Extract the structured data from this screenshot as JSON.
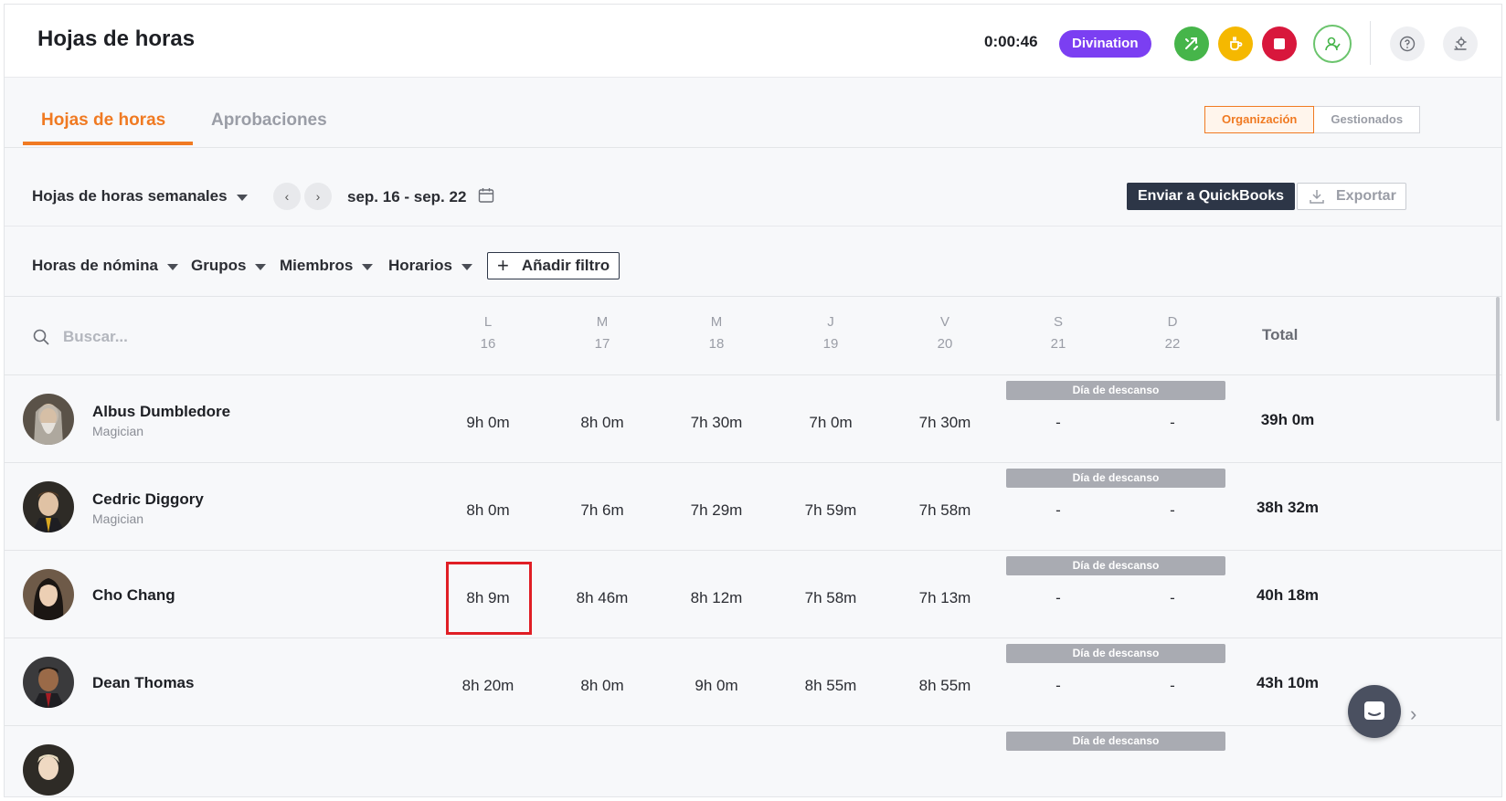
{
  "header": {
    "title": "Hojas de horas",
    "timer": "0:00:46",
    "project": "Divination",
    "colors": {
      "switch": "#46b54a",
      "break": "#f5b800",
      "stop": "#d8173c",
      "project": "#7b3ff2"
    }
  },
  "tabs": {
    "timesheets": "Hojas de horas",
    "approvals": "Aprobaciones",
    "scope_org": "Organización",
    "scope_managed": "Gestionados"
  },
  "toolbar": {
    "period": "Hojas de horas semanales",
    "date_range": "sep. 16 - sep. 22",
    "quickbooks": "Enviar a QuickBooks",
    "export": "Exportar"
  },
  "filters": {
    "payroll": "Horas de nómina",
    "groups": "Grupos",
    "members": "Miembros",
    "schedules": "Horarios",
    "add": "Añadir filtro"
  },
  "table": {
    "search_placeholder": "Buscar...",
    "days": [
      {
        "letter": "L",
        "num": "16"
      },
      {
        "letter": "M",
        "num": "17"
      },
      {
        "letter": "M",
        "num": "18"
      },
      {
        "letter": "J",
        "num": "19"
      },
      {
        "letter": "V",
        "num": "20"
      },
      {
        "letter": "S",
        "num": "21"
      },
      {
        "letter": "D",
        "num": "22"
      }
    ],
    "total_label": "Total",
    "dayoff_label": "Día de descanso",
    "rows": [
      {
        "name": "Albus Dumbledore",
        "role": "Magician",
        "hours": [
          "9h 0m",
          "8h 0m",
          "7h 30m",
          "7h 0m",
          "7h 30m",
          "-",
          "-"
        ],
        "total": "39h 0m"
      },
      {
        "name": "Cedric Diggory",
        "role": "Magician",
        "hours": [
          "8h 0m",
          "7h 6m",
          "7h 29m",
          "7h 59m",
          "7h 58m",
          "-",
          "-"
        ],
        "total": "38h 32m"
      },
      {
        "name": "Cho Chang",
        "role": "",
        "hours": [
          "8h 9m",
          "8h 46m",
          "8h 12m",
          "7h 58m",
          "7h 13m",
          "-",
          "-"
        ],
        "total": "40h 18m"
      },
      {
        "name": "Dean Thomas",
        "role": "",
        "hours": [
          "8h 20m",
          "8h 0m",
          "9h 0m",
          "8h 55m",
          "8h 55m",
          "-",
          "-"
        ],
        "total": "43h 10m"
      }
    ]
  }
}
